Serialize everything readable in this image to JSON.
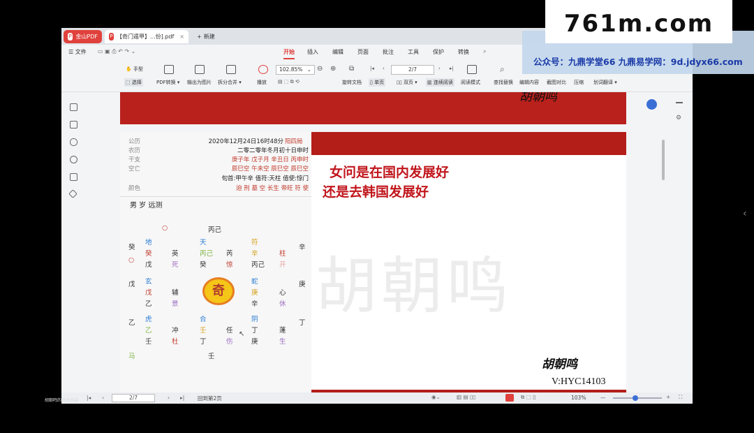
{
  "window": {
    "home_tab": "金山PDF",
    "doc_tab": "【奇门遁甲】...份].pdf",
    "new_tab": "新建"
  },
  "menu": {
    "file": "文件",
    "items": [
      "开始",
      "插入",
      "编辑",
      "页面",
      "批注",
      "工具",
      "保护",
      "转换"
    ]
  },
  "ribbon": {
    "hand": "手型",
    "select": "选择",
    "pdf_convert": "PDF转换",
    "export_image": "输出为图片",
    "split_merge": "拆分合并",
    "play": "播放",
    "zoom": "102.85%",
    "page": "2/7",
    "rotate": "旋转文档",
    "single": "单页",
    "double": "双页",
    "continuous": "连续阅读",
    "read_mode": "阅读模式",
    "find_replace": "查找替换",
    "edit_content": "编辑内容",
    "compare": "截图对比",
    "compress": "压缩",
    "translate": "划词翻译"
  },
  "overlay": {
    "site": "761m.com",
    "line": "公众号：九鼎学堂66 九鼎易学网：9d.jdyx66.com"
  },
  "chart": {
    "rows": [
      {
        "label": "公历",
        "value": "2020年12月24日16时48分",
        "extra": "阳四局"
      },
      {
        "label": "农历",
        "value": "二零二零年冬月初十日申时",
        "extra": ""
      },
      {
        "label": "干支",
        "value": "庚子年 戊子月 辛丑日 丙申时",
        "extra": ""
      },
      {
        "label": "空亡",
        "value": "辰巳空 午未空 辰巳空 辰巳空",
        "extra": ""
      },
      {
        "label": "",
        "value": "旬首:甲午辛  值符:天柱  值使:惊门",
        "extra": ""
      },
      {
        "label": "颜色",
        "value": "迫 刑 墓 空 长生 帝旺 符 使",
        "extra": ""
      }
    ],
    "subject": "男 岁 远测",
    "top_circle": "○",
    "top_stems": "丙己",
    "bottom_stem": "壬",
    "bottom_left": "马",
    "side_left": [
      "癸",
      "○",
      "戊",
      "乙"
    ],
    "side_right": [
      "辛",
      "庚",
      "丁"
    ],
    "palaces": [
      {
        "god": "地",
        "a": "癸",
        "star": "英",
        "b": "戊",
        "door": "死"
      },
      {
        "god": "天",
        "a": "丙己",
        "star": "芮",
        "b": "癸",
        "door": "惊"
      },
      {
        "god": "符",
        "a": "辛",
        "star": "柱",
        "b": "丙己",
        "door": "开"
      },
      {
        "god": "玄",
        "a": "戊",
        "star": "辅",
        "b": "乙",
        "door": "景"
      },
      {
        "god": "",
        "a": "",
        "star": "",
        "b": "",
        "door": ""
      },
      {
        "god": "蛇",
        "a": "庚",
        "star": "心",
        "b": "辛",
        "door": "休"
      },
      {
        "god": "虎",
        "a": "乙",
        "star": "冲",
        "b": "壬",
        "door": "杜"
      },
      {
        "god": "合",
        "a": "壬",
        "star": "任",
        "b": "丁",
        "door": "伤"
      },
      {
        "god": "阴",
        "a": "丁",
        "star": "蓬",
        "b": "庚",
        "door": "生"
      }
    ],
    "center_logo": "奇"
  },
  "question": [
    "女问是在国内发展好",
    "还是去韩国发展好"
  ],
  "watermark": "胡朝鸣",
  "signature": "胡朝鸣",
  "contact": "V:HYC14103",
  "status": {
    "page": "2/7",
    "back": "回到第2页",
    "zoom": "103%"
  },
  "caption": "胡朝鸣的共享屏幕"
}
